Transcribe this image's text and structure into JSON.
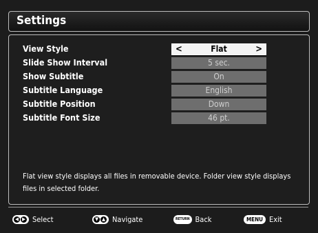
{
  "header": {
    "title": "Settings"
  },
  "settings": [
    {
      "label": "View Style",
      "value": "Flat",
      "active": true
    },
    {
      "label": "Slide Show Interval",
      "value": "5 sec."
    },
    {
      "label": "Show Subtitle",
      "value": "On"
    },
    {
      "label": "Subtitle Language",
      "value": "English"
    },
    {
      "label": "Subtitle Position",
      "value": "Down"
    },
    {
      "label": "Subtitle Font Size",
      "value": "46 pt."
    }
  ],
  "description": "Flat view style displays all files in removable device. Folder view style displays files in selected folder.",
  "footer": {
    "select": {
      "label": "Select",
      "icon": "left-right-arrows-icon"
    },
    "navigate": {
      "label": "Navigate",
      "icon": "up-down-arrows-icon"
    },
    "back": {
      "key": "RETURN",
      "label": "Back"
    },
    "exit": {
      "key": "MENU",
      "label": "Exit"
    }
  },
  "colors": {
    "background": "#1c1c1c",
    "value_box": "#6e6e6e",
    "active_box": "#f4f4f4"
  }
}
